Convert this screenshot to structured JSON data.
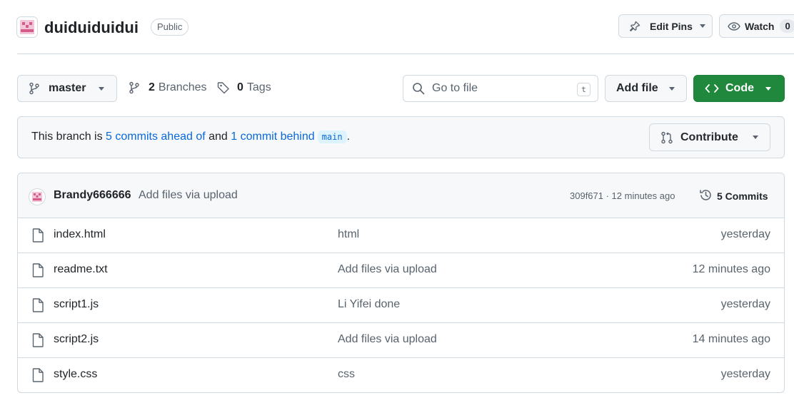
{
  "repo": {
    "name": "duiduiduidui",
    "visibility": "Public"
  },
  "header_actions": {
    "edit_pins": "Edit Pins",
    "watch": "Watch",
    "watch_count": "0"
  },
  "toolbar": {
    "branch": "master",
    "branches_count": "2",
    "branches_label": "Branches",
    "tags_count": "0",
    "tags_label": "Tags",
    "goto_placeholder": "Go to file",
    "goto_shortcut": "t",
    "add_file": "Add file",
    "code": "Code"
  },
  "compare": {
    "prefix": "This branch is ",
    "ahead": "5 commits ahead of",
    "middle": " and ",
    "behind": "1 commit behind",
    "base": "main",
    "suffix": ".",
    "contribute": "Contribute"
  },
  "latest_commit": {
    "author": "Brandy666666",
    "message": "Add files via upload",
    "meta": "309f671 · 12 minutes ago",
    "commits": "5 Commits"
  },
  "files": [
    {
      "name": "index.html",
      "message": "html",
      "time": "yesterday"
    },
    {
      "name": "readme.txt",
      "message": "Add files via upload",
      "time": "12 minutes ago"
    },
    {
      "name": "script1.js",
      "message": "Li Yifei done",
      "time": "yesterday"
    },
    {
      "name": "script2.js",
      "message": "Add files via upload",
      "time": "14 minutes ago"
    },
    {
      "name": "style.css",
      "message": "css",
      "time": "yesterday"
    }
  ],
  "colors": {
    "accent_green": "#1f883d",
    "link_blue": "#0969da",
    "avatar_pink": "#d45b8a"
  },
  "icons": [
    "repo-avatar-icon",
    "pin-icon",
    "eye-icon",
    "git-branch-icon",
    "tag-icon",
    "search-icon",
    "code-icon",
    "git-pull-request-icon",
    "history-icon",
    "file-icon"
  ]
}
